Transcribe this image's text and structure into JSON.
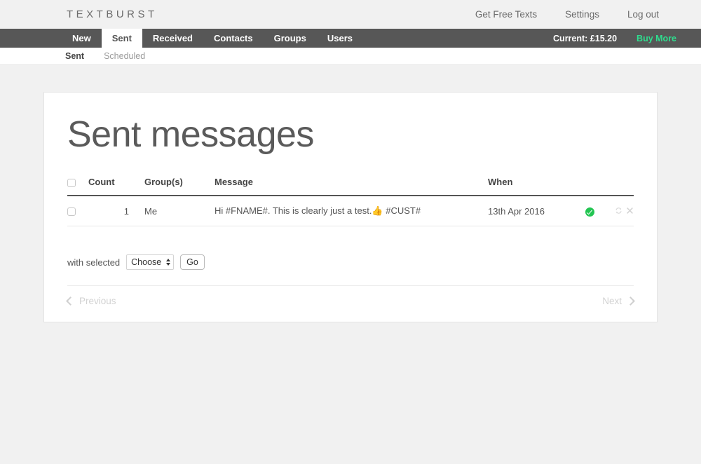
{
  "header": {
    "brand": "TEXTBURST",
    "links": [
      {
        "label": "Get Free Texts",
        "name": "get-free-texts"
      },
      {
        "label": "Settings",
        "name": "settings"
      },
      {
        "label": "Log out",
        "name": "log-out"
      }
    ]
  },
  "nav": {
    "items": [
      {
        "label": "New",
        "active": false
      },
      {
        "label": "Sent",
        "active": true
      },
      {
        "label": "Received",
        "active": false
      },
      {
        "label": "Contacts",
        "active": false
      },
      {
        "label": "Groups",
        "active": false
      },
      {
        "label": "Users",
        "active": false
      }
    ],
    "balance_label": "Current: £15.20",
    "buy_more_label": "Buy More",
    "buy_more_color": "#2fdd8f",
    "bar_color": "#575757"
  },
  "subnav": {
    "items": [
      {
        "label": "Sent",
        "active": true
      },
      {
        "label": "Scheduled",
        "active": false
      }
    ]
  },
  "main": {
    "title": "Sent messages",
    "table": {
      "columns": [
        "",
        "Count",
        "Group(s)",
        "Message",
        "When",
        "",
        ""
      ],
      "headers": {
        "count": "Count",
        "groups": "Group(s)",
        "message": "Message",
        "when": "When"
      },
      "rows": [
        {
          "selected": false,
          "count": "1",
          "groups": "Me",
          "message": "Hi #FNAME#. This is clearly just a test.👍 #CUST#",
          "when": "13th Apr 2016",
          "status": "delivered",
          "status_color": "#23c552",
          "actions": [
            "resend-icon",
            "delete-icon"
          ]
        }
      ]
    },
    "bulk": {
      "label": "with selected",
      "select_value": "Choose",
      "select_options": [
        "Choose"
      ],
      "go_label": "Go"
    },
    "pager": {
      "previous_label": "Previous",
      "next_label": "Next"
    }
  }
}
